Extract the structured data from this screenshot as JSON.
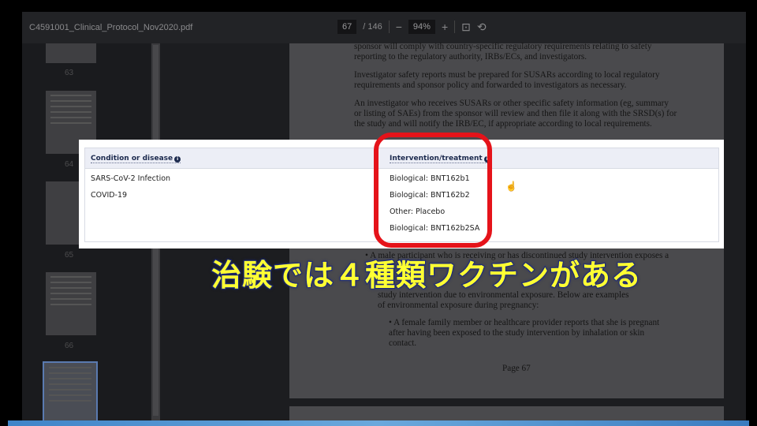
{
  "toolbar": {
    "filename": "C4591001_Clinical_Protocol_Nov2020.pdf",
    "current_page": "67",
    "total_pages": "/ 146",
    "zoom": "94%",
    "zoom_out": "−",
    "zoom_in": "+",
    "fit_icon": "fit-page-icon",
    "rotate_icon": "rotate-icon"
  },
  "thumbnails": [
    {
      "label": "63"
    },
    {
      "label": "64"
    },
    {
      "label": "65"
    },
    {
      "label": "66"
    }
  ],
  "page": {
    "paragraphs": [
      "sponsor will comply with country-specific regulatory requirements relating to safety reporting to the regulatory authority, IRBs/ECs, and investigators.",
      "Investigator safety reports must be prepared for SUSARs according to local regulatory requirements and sponsor policy and forwarded to investigators as necessary.",
      "An investigator who receives SUSARs or other specific safety information (eg, summary or listing of SAEs) from the sponsor will review and then file it along with the SRSD(s) for the study and will notify the IRB/EC, if appropriate according to local requirements.",
      "•  A male participant who is receiving or has discontinued study intervention exposes a",
      "study intervention due to environmental exposure.  Below are examples of environmental exposure during pregnancy:",
      "•  A female family member or healthcare provider reports that she is pregnant after having been exposed to the study intervention by inhalation or skin contact."
    ],
    "footer": "Page 67"
  },
  "overlay": {
    "col1_header": "Condition or disease",
    "col2_header": "Intervention/treatment",
    "info": "i",
    "conditions": [
      "SARS-CoV-2 Infection",
      "COVID-19"
    ],
    "interventions": [
      "Biological: BNT162b1",
      "Biological: BNT162b2",
      "Other: Placebo",
      "Biological: BNT162b2SA"
    ]
  },
  "caption": "治験では４種類ワクチンがある",
  "colors": {
    "highlight": "#e5131a",
    "caption": "#ffff33"
  }
}
